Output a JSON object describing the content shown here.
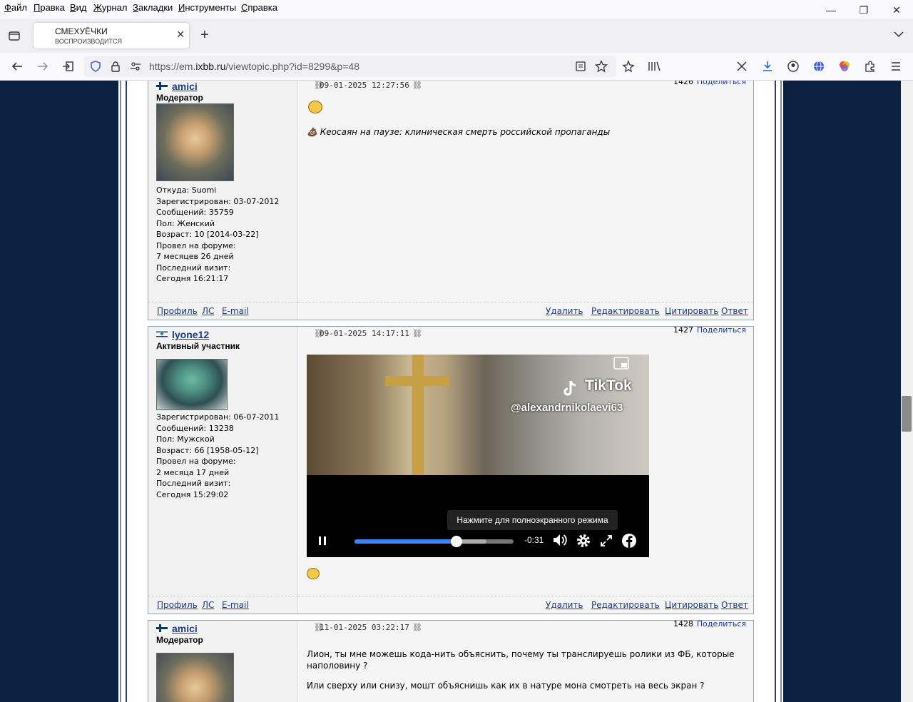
{
  "menu": [
    "Файл",
    "Правка",
    "Вид",
    "Журнал",
    "Закладки",
    "Инструменты",
    "Справка"
  ],
  "window": {
    "minimize": "—",
    "restore": "❐",
    "close": "✕"
  },
  "tab": {
    "title": "СМЕХУЁЧКИ",
    "subtitle": "ВОСПРОИЗВОДИТСЯ",
    "close": "✕",
    "new_tab": "+"
  },
  "nav": {
    "url_prefix": "https://em.",
    "url_domain": "ixbb.ru",
    "url_path": "/viewtopic.php?id=8299&p=48"
  },
  "posts": [
    {
      "user": "amici",
      "rank": "Модератор",
      "flag": "fi",
      "info": [
        "Откуда: Suomi",
        "Зарегистрирован: 03-07-2012",
        "Сообщений: 35759",
        "Пол: Женский",
        "Возраст: 10 [2014-03-22]",
        "Провел на форуме:",
        "7 месяцев 26 дней",
        "Последний визит:",
        "Сегодня 16:21:17"
      ],
      "date": "09-01-2025 12:27:56",
      "number": "1426",
      "share": "Поделиться",
      "text": "💩 Кеосаян на паузе: клиническая смерть российской пропаганды",
      "footer_left": [
        "Профиль",
        "ЛС",
        "E-mail"
      ],
      "footer_right": [
        "Удалить",
        "Редактировать",
        "Цитировать",
        "Ответ"
      ]
    },
    {
      "user": "lyone12",
      "rank": "Активный участник",
      "flag": "il",
      "info": [
        "Зарегистрирован: 06-07-2011",
        "Сообщений: 13238",
        "Пол: Мужской",
        "Возраст: 66 [1958-05-12]",
        "Провел на форуме:",
        "2 месяца 17 дней",
        "Последний визит:",
        "Сегодня 15:29:02"
      ],
      "date": "09-01-2025 14:17:11",
      "number": "1427",
      "share": "Поделиться",
      "video": {
        "brand": "TikTok",
        "handle": "@alexandrnikolaevi63",
        "tooltip": "Нажмите для полноэкранного режима",
        "remaining": "-0:31",
        "progress": 0.64,
        "buffered": 0.83
      },
      "footer_left": [
        "Профиль",
        "ЛС",
        "E-mail"
      ],
      "footer_right": [
        "Удалить",
        "Редактировать",
        "Цитировать",
        "Ответ"
      ]
    },
    {
      "user": "amici",
      "rank": "Модератор",
      "flag": "fi",
      "date": "11-01-2025 03:22:17",
      "number": "1428",
      "share": "Поделиться",
      "text1": "Лион, ты мне можешь кода-нить объяснить, почему ты транслируешь ролики из ФБ, которые",
      "text2": "наполовину ?",
      "text3": "Или сверху или снизу, мошт объяснишь как их в натуре мона смотреть на весь экран ?"
    }
  ]
}
